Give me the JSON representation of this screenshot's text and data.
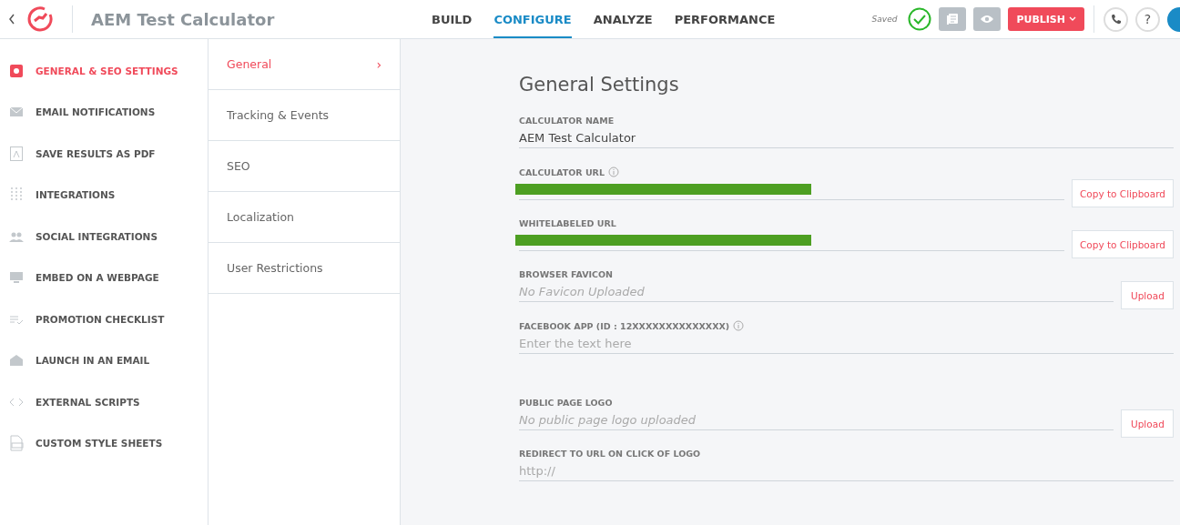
{
  "app_title": "AEM Test Calculator",
  "nav_tabs": [
    {
      "label": "BUILD",
      "selected": false
    },
    {
      "label": "CONFIGURE",
      "selected": true
    },
    {
      "label": "ANALYZE",
      "selected": false
    },
    {
      "label": "PERFORMANCE",
      "selected": false
    }
  ],
  "save_status": "Saved",
  "publish_button": "PUBLISH",
  "help_button": "?",
  "sidebar": {
    "items": [
      {
        "label": "GENERAL & SEO SETTINGS",
        "kind": "gear",
        "selected": true
      },
      {
        "label": "EMAIL NOTIFICATIONS",
        "kind": "mail",
        "selected": false
      },
      {
        "label": "SAVE RESULTS AS PDF",
        "kind": "pdf",
        "selected": false
      },
      {
        "label": "INTEGRATIONS",
        "kind": "grid",
        "selected": false
      },
      {
        "label": "SOCIAL INTEGRATIONS",
        "kind": "people",
        "selected": false
      },
      {
        "label": "EMBED ON A WEBPAGE",
        "kind": "monitor",
        "selected": false
      },
      {
        "label": "PROMOTION CHECKLIST",
        "kind": "checklist",
        "selected": false
      },
      {
        "label": "LAUNCH IN AN EMAIL",
        "kind": "openmail",
        "selected": false
      },
      {
        "label": "EXTERNAL SCRIPTS",
        "kind": "code",
        "selected": false
      },
      {
        "label": "CUSTOM STYLE SHEETS",
        "kind": "css",
        "selected": false
      }
    ]
  },
  "subnav": {
    "items": [
      {
        "label": "General",
        "selected": true,
        "chevron": "›"
      },
      {
        "label": "Tracking & Events",
        "selected": false
      },
      {
        "label": "SEO",
        "selected": false
      },
      {
        "label": "Localization",
        "selected": false
      },
      {
        "label": "User Restrictions",
        "selected": false
      }
    ]
  },
  "section_title": "General Settings",
  "fields": [
    {
      "kind": "text",
      "label": "CALCULATOR NAME",
      "info": false,
      "value": "AEM Test Calculator"
    },
    {
      "kind": "url",
      "label": "CALCULATOR URL",
      "info": true,
      "button": "Copy to Clipboard"
    },
    {
      "kind": "url",
      "label": "WHITELABELED URL",
      "info": false,
      "button": "Copy to Clipboard"
    },
    {
      "kind": "file",
      "label": "BROWSER FAVICON",
      "info": false,
      "placeholder": "No Favicon Uploaded",
      "button": "Upload"
    },
    {
      "kind": "input",
      "label": "FACEBOOK APP (ID : 12XXXXXXXXXXXXXX)",
      "info": true,
      "placeholder": "Enter the text here"
    },
    {
      "kind": "file",
      "label": "PUBLIC PAGE LOGO",
      "placeholder": "No public page logo uploaded",
      "button": "Upload",
      "info": false
    },
    {
      "kind": "input",
      "label": "REDIRECT TO URL ON CLICK OF LOGO",
      "info": false,
      "placeholder": "http://"
    }
  ]
}
